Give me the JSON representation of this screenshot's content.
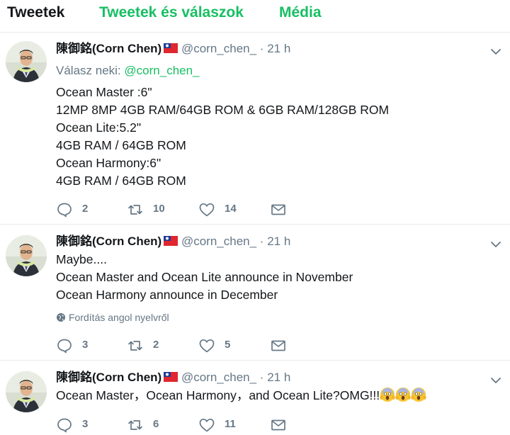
{
  "tabs": [
    {
      "label": "Tweetek"
    },
    {
      "label": "Tweetek és válaszok"
    },
    {
      "label": "Média"
    }
  ],
  "colors": {
    "accent": "#17bf63",
    "muted": "#657786",
    "text": "#14171a"
  },
  "tweets": [
    {
      "author": "陳御銘(Corn Chen)",
      "handle": "@corn_chen_",
      "dot": "·",
      "time": "21 h",
      "reply_prefix": "Válasz neki:",
      "reply_to": "@corn_chen_",
      "lines": [
        "Ocean Master :6\"",
        "12MP 8MP 4GB RAM/64GB ROM & 6GB RAM/128GB ROM",
        "Ocean Lite:5.2\"",
        "4GB RAM / 64GB ROM",
        "Ocean Harmony:6\"",
        "4GB RAM / 64GB ROM"
      ],
      "replies": "2",
      "retweets": "10",
      "likes": "14"
    },
    {
      "author": "陳御銘(Corn Chen)",
      "handle": "@corn_chen_",
      "dot": "·",
      "time": "21 h",
      "lines": [
        "Maybe....",
        "Ocean Master and Ocean Lite announce in November",
        "Ocean Harmony announce in December"
      ],
      "translate": "Fordítás angol nyelvről",
      "replies": "3",
      "retweets": "2",
      "likes": "5"
    },
    {
      "author": "陳御銘(Corn Chen)",
      "handle": "@corn_chen_",
      "dot": "·",
      "time": "21 h",
      "lines": [
        "Ocean Master，Ocean Harmony，and Ocean Lite?OMG!!!"
      ],
      "replies": "3",
      "retweets": "6",
      "likes": "11"
    }
  ]
}
